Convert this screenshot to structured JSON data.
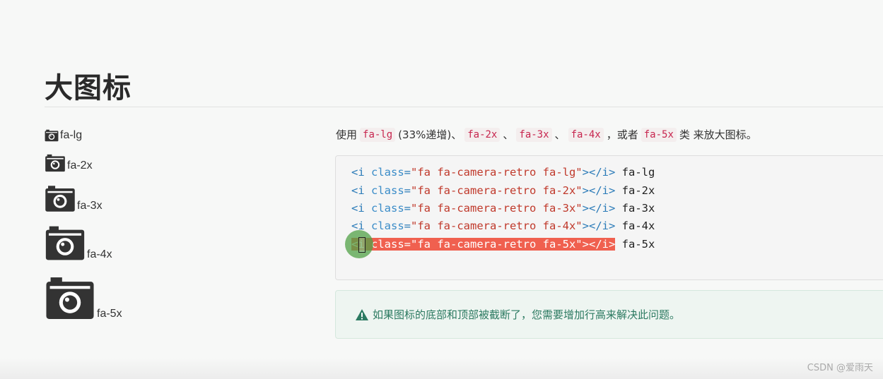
{
  "page": {
    "title": "大图标"
  },
  "icon_examples": [
    {
      "label": "fa-lg",
      "icon": "camera-retro-icon"
    },
    {
      "label": "fa-2x",
      "icon": "camera-retro-icon"
    },
    {
      "label": "fa-3x",
      "icon": "camera-retro-icon"
    },
    {
      "label": "fa-4x",
      "icon": "camera-retro-icon"
    },
    {
      "label": "fa-5x",
      "icon": "camera-retro-icon"
    }
  ],
  "description": {
    "prefix": "使用",
    "code1": "fa-lg",
    "note": "(33%递增)、",
    "code2": "fa-2x",
    "sep1": "、",
    "code3": "fa-3x",
    "sep2": "、",
    "code4": "fa-4x",
    "mid": "，或者",
    "code5": "fa-5x",
    "suffix": "类 来放大图标。"
  },
  "code_lines": [
    {
      "open": "<i ",
      "attr": "class",
      "eq": "=",
      "value": "\"fa fa-camera-retro fa-lg\"",
      "close": "></i>",
      "text": " fa-lg"
    },
    {
      "open": "<i ",
      "attr": "class",
      "eq": "=",
      "value": "\"fa fa-camera-retro fa-2x\"",
      "close": "></i>",
      "text": " fa-2x"
    },
    {
      "open": "<i ",
      "attr": "class",
      "eq": "=",
      "value": "\"fa fa-camera-retro fa-3x\"",
      "close": "></i>",
      "text": " fa-3x"
    },
    {
      "open": "<i ",
      "attr": "class",
      "eq": "=",
      "value": "\"fa fa-camera-retro fa-4x\"",
      "close": "></i>",
      "text": " fa-4x"
    },
    {
      "open": "<i ",
      "attr": "class",
      "eq": "=",
      "value": "\"fa fa-camera-retro fa-5x\"",
      "close": "></i>",
      "text": " fa-5x"
    }
  ],
  "alert": {
    "icon": "warning-icon",
    "text": "如果图标的底部和顶部被截断了，您需要增加行高来解决此问题。"
  },
  "watermark": "CSDN @爱雨天",
  "colors": {
    "code_inline": "#c7254e",
    "selection": "#f0604f",
    "alert_text": "#2c7a61"
  }
}
